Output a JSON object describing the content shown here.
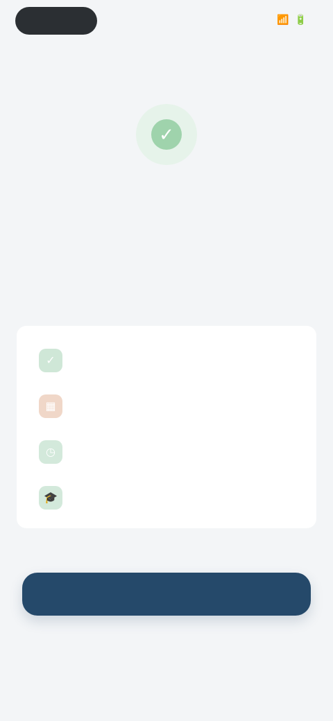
{
  "status_bar": {
    "pill_label": "",
    "right_text": ""
  },
  "hero": {
    "title": "",
    "subtitle": ""
  },
  "features": [
    {
      "label": "",
      "icon": "check-icon"
    },
    {
      "label": "",
      "icon": "calendar-icon"
    },
    {
      "label": "",
      "icon": "clock-icon"
    },
    {
      "label": "",
      "icon": "graduation-cap-icon"
    }
  ],
  "cta": {
    "primary_label": "",
    "secondary_label": ""
  },
  "colors": {
    "accent": "#25496a",
    "success": "#9fd3ac",
    "warning": "#e2b08f"
  }
}
